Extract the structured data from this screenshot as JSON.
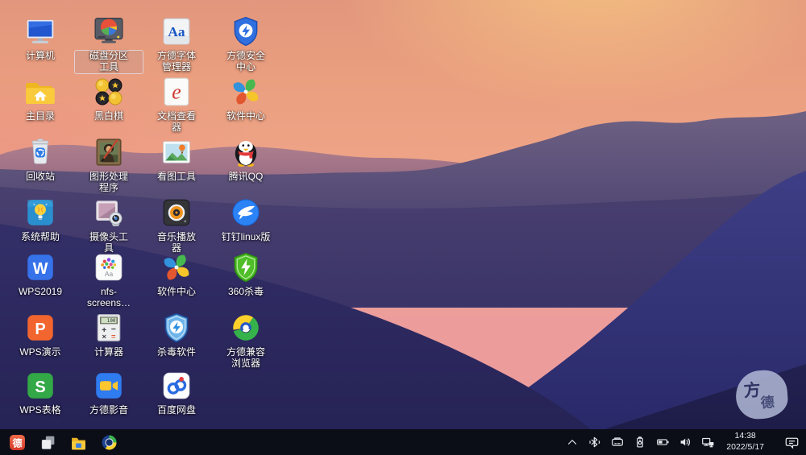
{
  "wallpaper": {
    "seal_top": "方",
    "seal_bottom": "德"
  },
  "desktop": {
    "icons": [
      {
        "name": "computer",
        "label": "计算机",
        "art": "computer",
        "row": 0,
        "col": 0,
        "selected": false
      },
      {
        "name": "disk-partition-tool",
        "label": "磁盘分区\n工具",
        "art": "disk-partition",
        "row": 0,
        "col": 1,
        "selected": true
      },
      {
        "name": "fangde-font-manager",
        "label": "方德字体\n管理器",
        "art": "font-manager",
        "row": 0,
        "col": 2,
        "selected": false
      },
      {
        "name": "fangde-security-center",
        "label": "方德安全\n中心",
        "art": "security-shield",
        "row": 0,
        "col": 3,
        "selected": false
      },
      {
        "name": "home-directory",
        "label": "主目录",
        "art": "home-folder",
        "row": 1,
        "col": 0,
        "selected": false
      },
      {
        "name": "othello-game",
        "label": "黑白棋",
        "art": "othello",
        "row": 1,
        "col": 1,
        "selected": false
      },
      {
        "name": "document-viewer",
        "label": "文档查看\n器",
        "art": "evince",
        "row": 1,
        "col": 2,
        "selected": false
      },
      {
        "name": "software-center",
        "label": "软件中心",
        "art": "pinwheel",
        "row": 1,
        "col": 3,
        "selected": false
      },
      {
        "name": "recycle-bin",
        "label": "回收站",
        "art": "recycle-bin",
        "row": 2,
        "col": 0,
        "selected": false
      },
      {
        "name": "graphics-editor",
        "label": "图形处理\n程序",
        "art": "gimp",
        "row": 2,
        "col": 1,
        "selected": false
      },
      {
        "name": "image-viewer",
        "label": "看图工具",
        "art": "photo-viewer",
        "row": 2,
        "col": 2,
        "selected": false
      },
      {
        "name": "tencent-qq",
        "label": "腾讯QQ",
        "art": "qq-penguin",
        "row": 2,
        "col": 3,
        "selected": false
      },
      {
        "name": "system-help",
        "label": "系统帮助",
        "art": "help-bulb",
        "row": 3,
        "col": 0,
        "selected": false
      },
      {
        "name": "camera-tool",
        "label": "摄像头工\n具",
        "art": "webcam",
        "row": 3,
        "col": 1,
        "selected": false
      },
      {
        "name": "music-player",
        "label": "音乐播放\n器",
        "art": "speaker",
        "row": 3,
        "col": 2,
        "selected": false
      },
      {
        "name": "dingtalk-linux",
        "label": "钉钉linux版",
        "art": "dingtalk-wing",
        "row": 3,
        "col": 3,
        "selected": false
      },
      {
        "name": "wps2019",
        "label": "WPS2019",
        "art": "wps-w",
        "row": 4,
        "col": 0,
        "selected": false
      },
      {
        "name": "nfs-screensaver",
        "label": "nfs-\nscreens…",
        "art": "screensaver-dots",
        "row": 4,
        "col": 1,
        "selected": false
      },
      {
        "name": "software-center-2",
        "label": "软件中心",
        "art": "pinwheel",
        "row": 4,
        "col": 2,
        "selected": false
      },
      {
        "name": "360-antivirus",
        "label": "360杀毒",
        "art": "shield-360",
        "row": 4,
        "col": 3,
        "selected": false
      },
      {
        "name": "wps-presentation",
        "label": "WPS演示",
        "art": "wps-p",
        "row": 5,
        "col": 0,
        "selected": false
      },
      {
        "name": "calculator",
        "label": "计算器",
        "art": "calculator",
        "row": 5,
        "col": 1,
        "selected": false
      },
      {
        "name": "antivirus-software",
        "label": "杀毒软件",
        "art": "shield-av",
        "row": 5,
        "col": 2,
        "selected": false
      },
      {
        "name": "fangde-browser",
        "label": "方德兼容\n浏览器",
        "art": "browser-swirl",
        "row": 5,
        "col": 3,
        "selected": false
      },
      {
        "name": "wps-spreadsheet",
        "label": "WPS表格",
        "art": "wps-s",
        "row": 6,
        "col": 0,
        "selected": false
      },
      {
        "name": "fangde-media",
        "label": "方德影音",
        "art": "media-camera",
        "row": 6,
        "col": 1,
        "selected": false
      },
      {
        "name": "baidu-netdisk",
        "label": "百度网盘",
        "art": "baidu-knot",
        "row": 6,
        "col": 2,
        "selected": false
      }
    ]
  },
  "taskbar": {
    "start_label": "德",
    "apps": [
      {
        "name": "window-switcher"
      },
      {
        "name": "file-manager"
      },
      {
        "name": "browser"
      }
    ],
    "tray": [
      {
        "name": "expand-tray"
      },
      {
        "name": "bluetooth"
      },
      {
        "name": "removable-drive"
      },
      {
        "name": "usb-device"
      },
      {
        "name": "battery"
      },
      {
        "name": "volume"
      },
      {
        "name": "network"
      }
    ],
    "clock": {
      "time": "14:38",
      "date": "2022/5/17"
    },
    "notification": {
      "name": "notification-center"
    }
  },
  "colors": {
    "taskbar_bg": "#0b0d17",
    "label_text": "#ffffff",
    "sky_top": "#e2967d",
    "sky_pink": "#ee9e98",
    "mountain_deep": "#1d1b47",
    "start_red": "#e0432e"
  }
}
